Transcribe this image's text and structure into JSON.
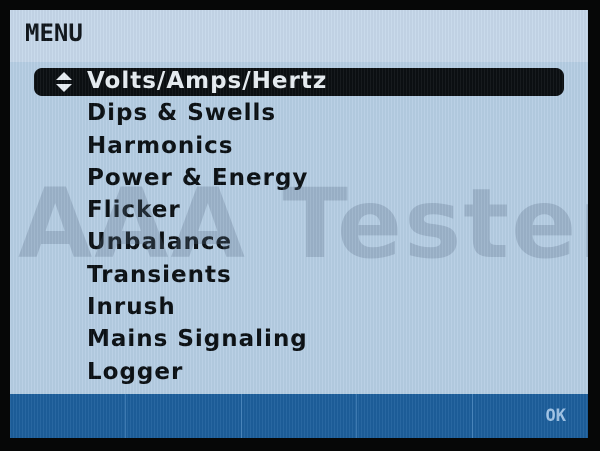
{
  "header": {
    "title": "MENU"
  },
  "menu": {
    "selected_index": 0,
    "items": [
      {
        "label": "Volts/Amps/Hertz"
      },
      {
        "label": "Dips & Swells"
      },
      {
        "label": "Harmonics"
      },
      {
        "label": "Power & Energy"
      },
      {
        "label": "Flicker"
      },
      {
        "label": "Unbalance"
      },
      {
        "label": "Transients"
      },
      {
        "label": "Inrush"
      },
      {
        "label": "Mains Signaling"
      },
      {
        "label": "Logger"
      }
    ]
  },
  "watermark": "AAA Testers",
  "softkeys": [
    {
      "label": ""
    },
    {
      "label": ""
    },
    {
      "label": ""
    },
    {
      "label": ""
    },
    {
      "label": "OK"
    }
  ],
  "colors": {
    "screen_bg": "#b6cee4",
    "title_bg": "#c6d8ea",
    "selection_bg": "#0b0f12",
    "softkey_bg": "#1d5f9c",
    "softkey_text": "#9fc3e6"
  },
  "icons": {
    "selected_item": "up-down-arrows-icon"
  }
}
